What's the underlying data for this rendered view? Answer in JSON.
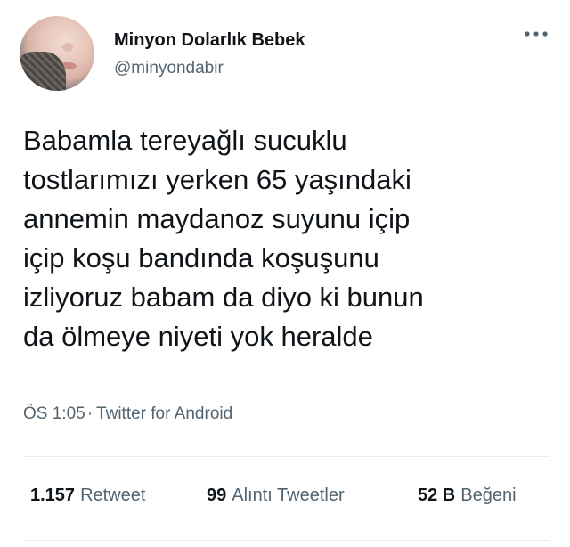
{
  "user": {
    "display_name": "Minyon Dolarlık Bebek",
    "handle": "@minyondabir"
  },
  "tweet": {
    "lines": [
      "Babamla tereyağlı sucuklu",
      "tostlarımızı yerken 65 yaşındaki",
      "annemin maydanoz suyunu içip",
      "içip koşu bandında koşuşunu",
      "izliyoruz babam da diyo ki bunun",
      "da ölmeye niyeti yok heralde"
    ]
  },
  "meta": {
    "time": "ÖS 1:05",
    "separator": "·",
    "source": "Twitter for Android"
  },
  "stats": {
    "retweets_count": "1.157",
    "retweets_label": "Retweet",
    "quotes_count": "99",
    "quotes_label": "Alıntı Tweetler",
    "likes_count": "52 B",
    "likes_label": "Beğeni"
  },
  "icons": {
    "more": "more-horizontal-icon"
  },
  "colors": {
    "text_primary": "#0f1419",
    "text_secondary": "#536471",
    "divider": "#e6ecf0"
  }
}
